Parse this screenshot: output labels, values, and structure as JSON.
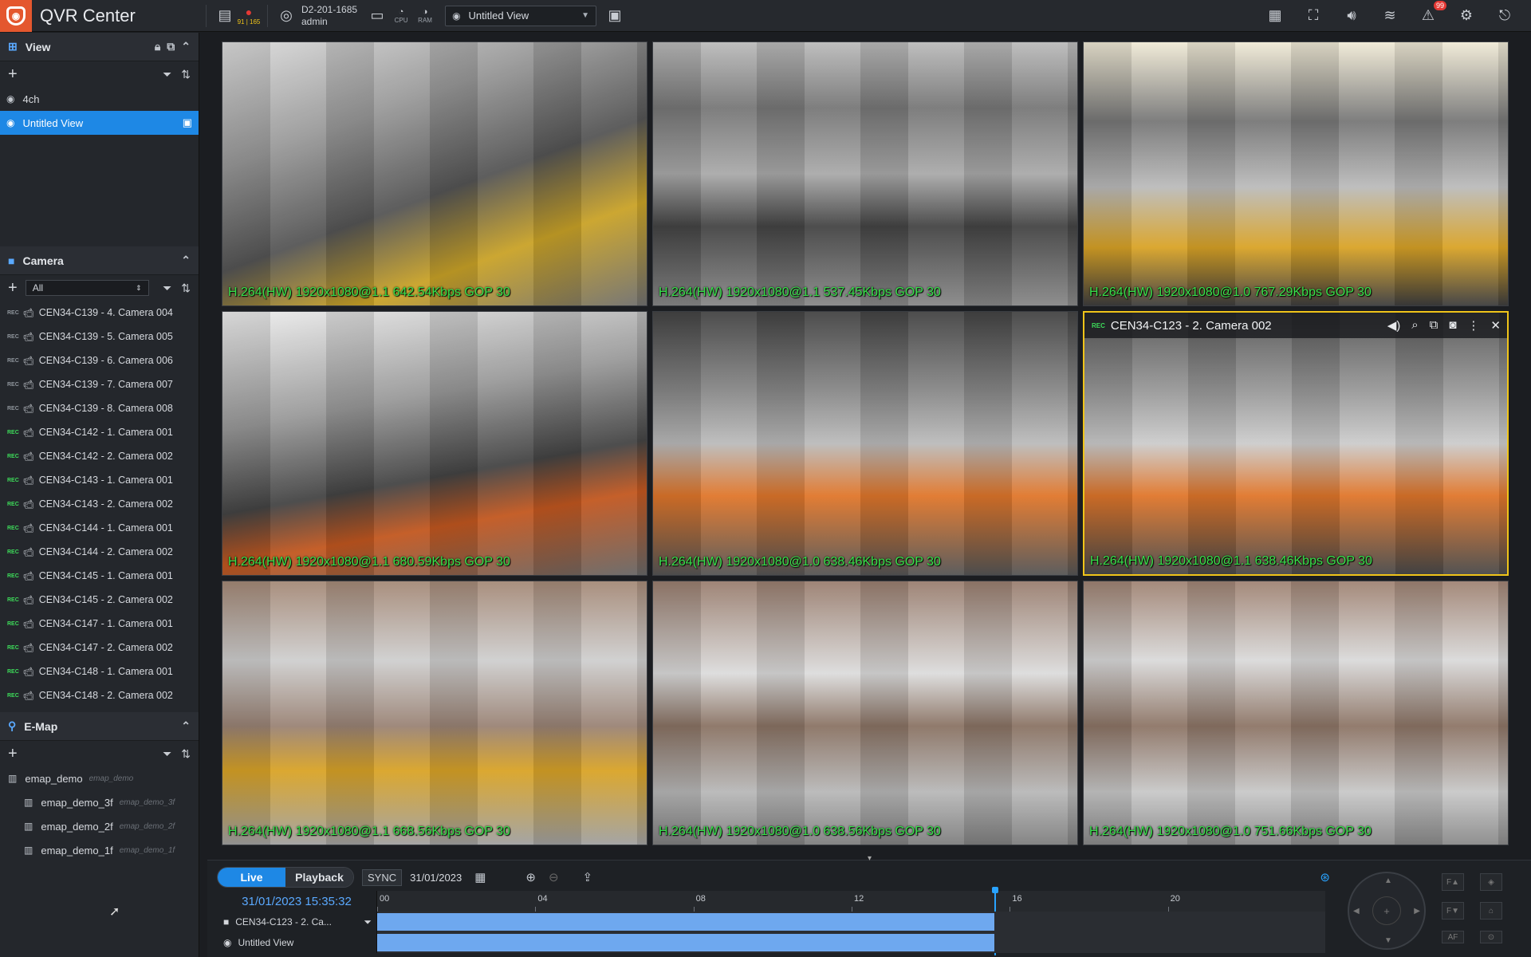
{
  "app": {
    "title": "QVR Center",
    "server_name": "D2-201-1685",
    "server_user": "admin",
    "server_counts": "91 | 165",
    "cpu_label": "CPU",
    "ram_label": "RAM",
    "current_view": "Untitled View",
    "alert_count": "99"
  },
  "sidebar": {
    "view_section": {
      "title": "View",
      "items": [
        {
          "label": "4ch"
        },
        {
          "label": "Untitled View"
        }
      ]
    },
    "camera_section": {
      "title": "Camera",
      "filter_value": "All",
      "items": [
        {
          "label": "CEN34-C139 - 4. Camera 004",
          "rec": "REC"
        },
        {
          "label": "CEN34-C139 - 5. Camera 005",
          "rec": "REC"
        },
        {
          "label": "CEN34-C139 - 6. Camera 006",
          "rec": "REC"
        },
        {
          "label": "CEN34-C139 - 7. Camera 007",
          "rec": "REC"
        },
        {
          "label": "CEN34-C139 - 8. Camera 008",
          "rec": "REC"
        },
        {
          "label": "CEN34-C142 - 1. Camera 001",
          "rec": "REC"
        },
        {
          "label": "CEN34-C142 - 2. Camera 002",
          "rec": "REC"
        },
        {
          "label": "CEN34-C143 - 1. Camera 001",
          "rec": "REC"
        },
        {
          "label": "CEN34-C143 - 2. Camera 002",
          "rec": "REC"
        },
        {
          "label": "CEN34-C144 - 1. Camera 001",
          "rec": "REC"
        },
        {
          "label": "CEN34-C144 - 2. Camera 002",
          "rec": "REC"
        },
        {
          "label": "CEN34-C145 - 1. Camera 001",
          "rec": "REC"
        },
        {
          "label": "CEN34-C145 - 2. Camera 002",
          "rec": "REC"
        },
        {
          "label": "CEN34-C147 - 1. Camera 001",
          "rec": "REC"
        },
        {
          "label": "CEN34-C147 - 2. Camera 002",
          "rec": "REC"
        },
        {
          "label": "CEN34-C148 - 1. Camera 001",
          "rec": "REC"
        },
        {
          "label": "CEN34-C148 - 2. Camera 002",
          "rec": "REC"
        }
      ]
    },
    "emap_section": {
      "title": "E-Map",
      "root": {
        "label": "emap_demo",
        "sub": "emap_demo"
      },
      "children": [
        {
          "label": "emap_demo_3f",
          "sub": "emap_demo_3f"
        },
        {
          "label": "emap_demo_2f",
          "sub": "emap_demo_2f"
        },
        {
          "label": "emap_demo_1f",
          "sub": "emap_demo_1f"
        }
      ]
    }
  },
  "tiles": [
    {
      "osd": "H.264(HW) 1920x1080@1.1 642.54Kbps GOP 30"
    },
    {
      "osd": "H.264(HW) 1920x1080@1.1 537.45Kbps GOP 30"
    },
    {
      "osd": "H.264(HW) 1920x1080@1.0 767.29Kbps GOP 30"
    },
    {
      "osd": "H.264(HW) 1920x1080@1.1 680.59Kbps GOP 30"
    },
    {
      "osd": "H.264(HW) 1920x1080@1.0 638.46Kbps GOP 30"
    },
    {
      "osd": "H.264(HW) 1920x1080@1.1 638.46Kbps GOP 30",
      "title": "CEN34-C123 - 2. Camera 002"
    },
    {
      "osd": "H.264(HW) 1920x1080@1.1 668.56Kbps GOP 30"
    },
    {
      "osd": "H.264(HW) 1920x1080@1.0 638.56Kbps GOP 30"
    },
    {
      "osd": "H.264(HW) 1920x1080@1.0 751.66Kbps GOP 30"
    }
  ],
  "timeline": {
    "live_label": "Live",
    "playback_label": "Playback",
    "sync_label": "SYNC",
    "date": "31/01/2023",
    "current_time": "31/01/2023 15:35:32",
    "ticks": [
      "00",
      "04",
      "08",
      "12",
      "16",
      "20"
    ],
    "rows": [
      {
        "label": "CEN34-C123 - 2. Ca..."
      },
      {
        "label": "Untitled View"
      }
    ],
    "recorded_until_hour": 15.6,
    "cursor_hour": 15.6
  },
  "colors": {
    "accent": "#1e88e5",
    "osd_text": "#38e04a",
    "active_border": "#f0c419",
    "brand": "#e4572e"
  }
}
